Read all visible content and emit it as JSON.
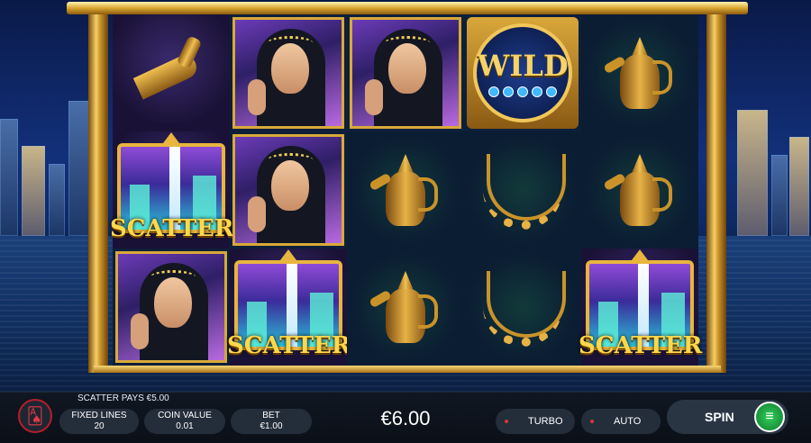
{
  "game": {
    "message": "SCATTER PAYS €5.00",
    "balance": "€6.00",
    "controls": {
      "fixed_lines_label": "FIXED LINES",
      "fixed_lines_value": "20",
      "coin_value_label": "COIN VALUE",
      "coin_value_value": "0.01",
      "bet_label": "BET",
      "bet_value": "€1.00",
      "turbo_label": "TURBO",
      "auto_label": "AUTO",
      "spin_label": "SPIN"
    },
    "symbols": {
      "scatter_text": "SCATTER",
      "wild_text": "WILD"
    },
    "grid": [
      [
        "dagger",
        "woman",
        "woman",
        "wild",
        "teapot"
      ],
      [
        "scatter",
        "woman",
        "teapot",
        "necklace",
        "teapot"
      ],
      [
        "woman",
        "scatter",
        "teapot",
        "necklace",
        "scatter"
      ]
    ]
  }
}
